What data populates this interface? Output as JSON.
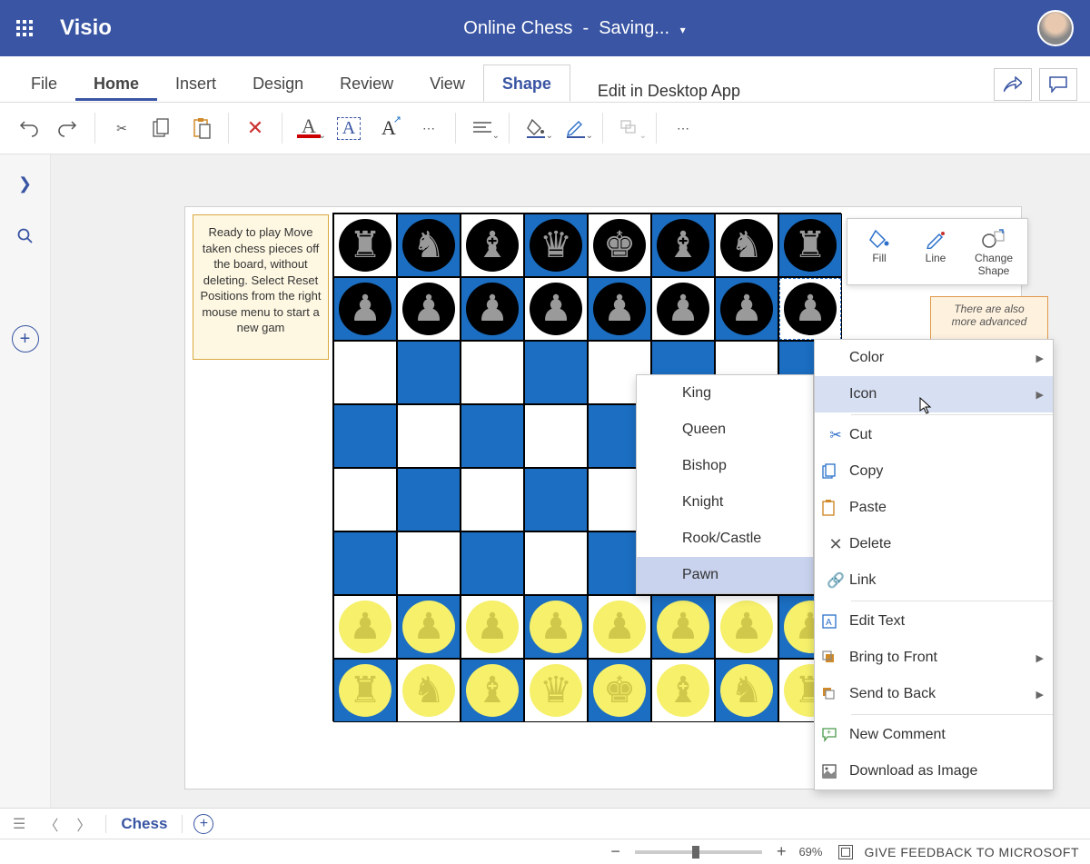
{
  "header": {
    "app_name": "Visio",
    "doc_title": "Online Chess",
    "doc_status": "Saving..."
  },
  "ribbon": {
    "tabs": [
      "File",
      "Home",
      "Insert",
      "Design",
      "Review",
      "View",
      "Shape"
    ],
    "underlined_tab": "Home",
    "active_tab": "Shape",
    "edit_desktop": "Edit in Desktop App"
  },
  "canvas": {
    "note1": "Ready to play Move taken chess pieces off the board, without deleting. Select Reset Positions from the right mouse menu to start a new gam",
    "note2_line1": "There are also",
    "note2_line2": "more advanced"
  },
  "board": {
    "pieces_row_back": [
      "♜",
      "♞",
      "♝",
      "♛",
      "♚",
      "♝",
      "♞",
      "♜"
    ],
    "pieces_row_pawns": [
      "♟",
      "♟",
      "♟",
      "♟",
      "♟",
      "♟",
      "♟",
      "♟"
    ],
    "selected": {
      "row": 1,
      "col": 7
    }
  },
  "mini_toolbar": {
    "fill": "Fill",
    "line": "Line",
    "change_shape": "Change Shape"
  },
  "context_menu": {
    "color": "Color",
    "icon": "Icon",
    "cut": "Cut",
    "copy": "Copy",
    "paste": "Paste",
    "delete": "Delete",
    "link": "Link",
    "edit_text": "Edit Text",
    "bring_front": "Bring to Front",
    "send_back": "Send to Back",
    "new_comment": "New Comment",
    "download_img": "Download as Image"
  },
  "submenu": {
    "items": [
      "King",
      "Queen",
      "Bishop",
      "Knight",
      "Rook/Castle",
      "Pawn"
    ],
    "selected": "Pawn"
  },
  "page_tabs": {
    "active": "Chess"
  },
  "statusbar": {
    "zoom": "69%",
    "feedback": "GIVE FEEDBACK TO MICROSOFT"
  }
}
